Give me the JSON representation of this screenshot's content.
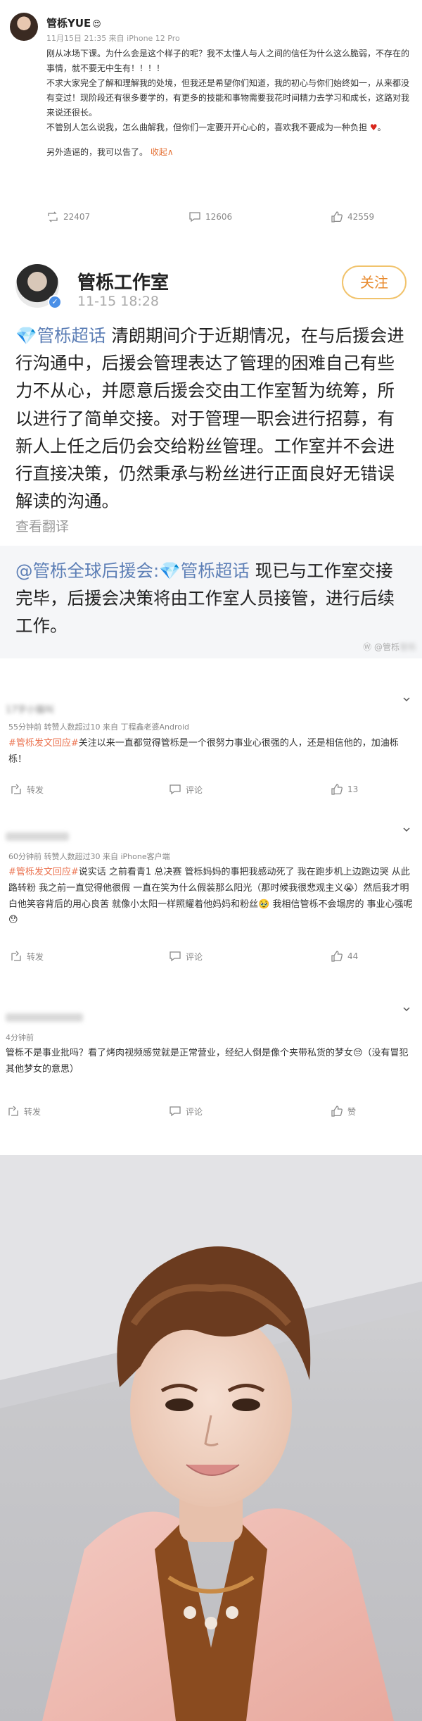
{
  "post1": {
    "author": "管栎YUE",
    "emoji": "😍",
    "meta": "11月15日 21:35  来自 iPhone 12 Pro",
    "paragraphs": [
      "刚从冰场下课。为什么会是这个样子的呢？我不太懂人与人之间的信任为什么这么脆弱，不存在的事情，就不要无中生有！！！！",
      "不求大家完全了解和理解我的处境，但我还是希望你们知道，我的初心与你们始终如一，从来都没有变过！现阶段还有很多要学的，有更多的技能和事物需要我花时间精力去学习和成长，这路对我来说还很长。",
      "不管别人怎么说我，怎么曲解我，但你们一定要开开心心的，喜欢我不要成为一种负担",
      "另外造谣的，我可以告了。"
    ],
    "collapse": "收起∧",
    "actions": {
      "repost": "22407",
      "comment": "12606",
      "like": "42559"
    }
  },
  "post2": {
    "author": "管栎工作室",
    "time": "11-15 18:28",
    "follow": "关注",
    "topic": "管栎超话",
    "body": "清朗期间介于近期情况，在与后援会进行沟通中，后援会管理表达了管理的困难自己有些力不从心，并愿意后援会交由工作室暂为统筹，所以进行了简单交接。对于管理一职会进行招募，有新人上任之后仍会交给粉丝管理。工作室并不会进行直接决策，仍然秉承与粉丝进行正面良好无错误解读的沟通。",
    "translate": "查看翻译",
    "repost_mention": "@管栎全球后援会",
    "repost_topic": "管栎超话",
    "repost_body": "现已与工作室交接完毕，后援会决策将由工作室人员接管，进行后续工作。",
    "watermark": "@管栎"
  },
  "comment1": {
    "user": "17字小猫叫",
    "meta": "55分钟前  转赞人数超过10  来自 丁程鑫老婆Android",
    "text": "#管栎发文回应#关注以来一直都觉得管栎是一个很努力事业心很强的人，还是相信他的，加油栎栎！",
    "tag": "#管栎发文回应#",
    "actions": {
      "repost": "转发",
      "comment": "评论",
      "like": "13"
    }
  },
  "comment2": {
    "user": "",
    "meta": "60分钟前  转赞人数超过30  来自 iPhone客户端",
    "tag": "#管栎发文回应#",
    "text": "说实话 之前看青1 总决赛 管栎妈妈的事把我感动死了 我在跑步机上边跑边哭 从此路转粉 我之前一直觉得他很假 一直在笑为什么假装那么阳光（那时候我很悲观主义😭）然后我才明白他笑容背后的用心良苦 就像小太阳一样照耀着他妈妈和粉丝🥹 我相信管栎不会塌房的 事业心强呢😯",
    "actions": {
      "repost": "转发",
      "comment": "评论",
      "like": "44"
    }
  },
  "comment3": {
    "user": "",
    "meta": "4分钟前",
    "text": "管栎不是事业批吗？看了烤肉视频感觉就是正常营业，经纪人倒是像个夹带私货的梦女😒（没有冒犯其他梦女的意思）",
    "actions": {
      "repost": "转发",
      "comment": "评论",
      "like": "赞"
    }
  },
  "colors": {
    "orange": "#eb7350",
    "blue": "#5d7fb6",
    "link": "#e46f33"
  }
}
